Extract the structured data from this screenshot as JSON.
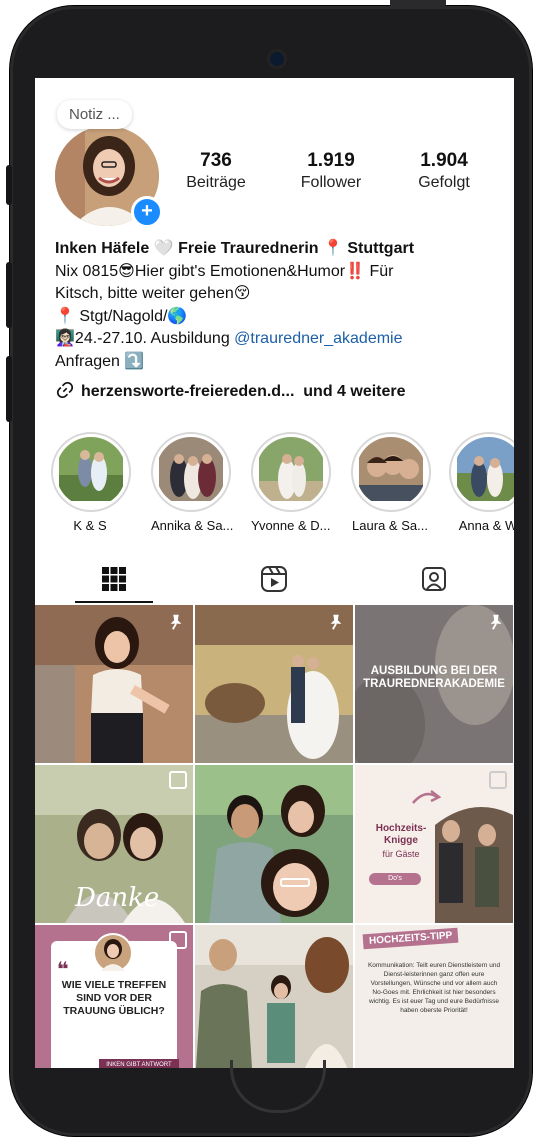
{
  "profile": {
    "note": "Notiz ...",
    "stats": [
      {
        "value": "736",
        "label": "Beiträge"
      },
      {
        "value": "1.919",
        "label": "Follower"
      },
      {
        "value": "1.904",
        "label": "Gefolgt"
      }
    ],
    "bio": {
      "line1": "Inken Häfele 🤍 Freie Traurednerin 📍 Stuttgart",
      "line2": "Nix 0815😎Hier gibt's Emotionen&Humor‼️ Für",
      "line3": "Kitsch, bitte weiter gehen😚",
      "line4": "📍 Stgt/Nagold/🌎",
      "line5_prefix": "👩🏻‍🏫24.-27.10. Ausbildung ",
      "line5_link": "@trauredner_akademie",
      "line6": "Anfragen ⤵️"
    },
    "link_text": "herzensworte-freiereden.d...",
    "link_more": "und 4 weitere"
  },
  "highlights": [
    {
      "label": "K & S"
    },
    {
      "label": "Annika & Sa..."
    },
    {
      "label": "Yvonne & D..."
    },
    {
      "label": "Laura & Sa..."
    },
    {
      "label": "Anna & W"
    }
  ],
  "tabs": [
    {
      "icon": "grid-icon"
    },
    {
      "icon": "reels-icon"
    },
    {
      "icon": "tagged-icon"
    }
  ],
  "posts": {
    "p3_text": "AUSBILDUNG BEI DER TRAUREDNERAKADEMIE",
    "p4_script": "Danke",
    "p6_title": "Hochzeits-Knigge",
    "p6_sub": "für Gäste",
    "p6_btn": "Do's",
    "p7_quote": "WIE VIELE TREFFEN SIND VOR DER TRAUUNG ÜBLICH?",
    "p7_footer": "INKEN GIBT ANTWORT",
    "p9_badge": "HOCHZEITS-TIPP",
    "p9_text": "Kommunikation: Teilt euren Dienstleistern und Dienst-leisterinnen ganz offen eure Vorstellungen, Wünsche und vor allem auch No-Goes mit. Ehrlichkeit ist hier besonders wichtig. Es ist euer Tag und eure Bedürfnisse haben oberste Priorität!"
  },
  "colors": {
    "link": "#1d5fa8",
    "plus_badge": "#1a8cff",
    "mauve": "#b5728f",
    "phone": "#1c1c1e"
  }
}
